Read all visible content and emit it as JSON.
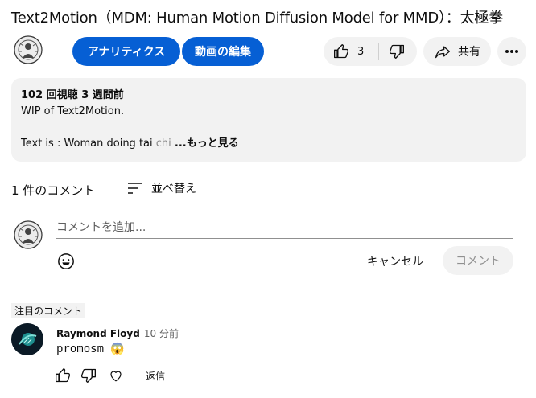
{
  "video": {
    "title": "Text2Motion（MDM: Human Motion Diffusion Model for MMD）：太極拳"
  },
  "actions": {
    "analytics_label": "アナリティクス",
    "edit_label": "動画の編集",
    "like_count": "3",
    "share_label": "共有"
  },
  "description": {
    "meta": "102 回視聴  3 週間前",
    "line1": "WIP of Text2Motion.",
    "line2_visible": "Text is : Woman doing tai ",
    "line2_faded": "chi",
    "more_label": "...もっと見る"
  },
  "comments": {
    "count_label": "1 件のコメント",
    "sort_label": "並べ替え",
    "add_placeholder": "コメントを追加...",
    "cancel_label": "キャンセル",
    "submit_label": "コメント",
    "pinned_label": "注目のコメント",
    "items": [
      {
        "author": "Raymond Floyd",
        "time": "10 分前",
        "text": "promosm 😱",
        "reply_label": "返信"
      }
    ]
  }
}
